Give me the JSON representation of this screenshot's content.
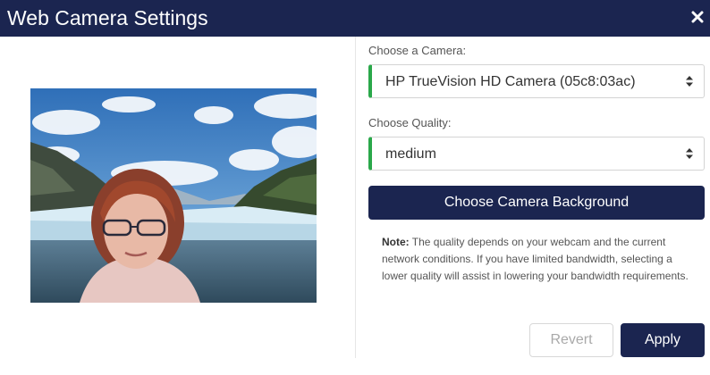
{
  "dialog": {
    "title": "Web Camera Settings",
    "close_icon": "close-icon"
  },
  "camera": {
    "label": "Choose a Camera:",
    "selected": "HP TrueVision HD Camera (05c8:03ac)"
  },
  "quality": {
    "label": "Choose Quality:",
    "selected": "medium"
  },
  "background_button": "Choose Camera Background",
  "note": {
    "bold": "Note:",
    "text": " The quality depends on your webcam and the current network conditions. If you have limited bandwidth, selecting a lower quality will assist in lowering your bandwidth requirements."
  },
  "buttons": {
    "revert": "Revert",
    "apply": "Apply"
  },
  "colors": {
    "header": "#1b2550",
    "accent_border": "#2aa84a",
    "primary_button": "#1b2550"
  }
}
